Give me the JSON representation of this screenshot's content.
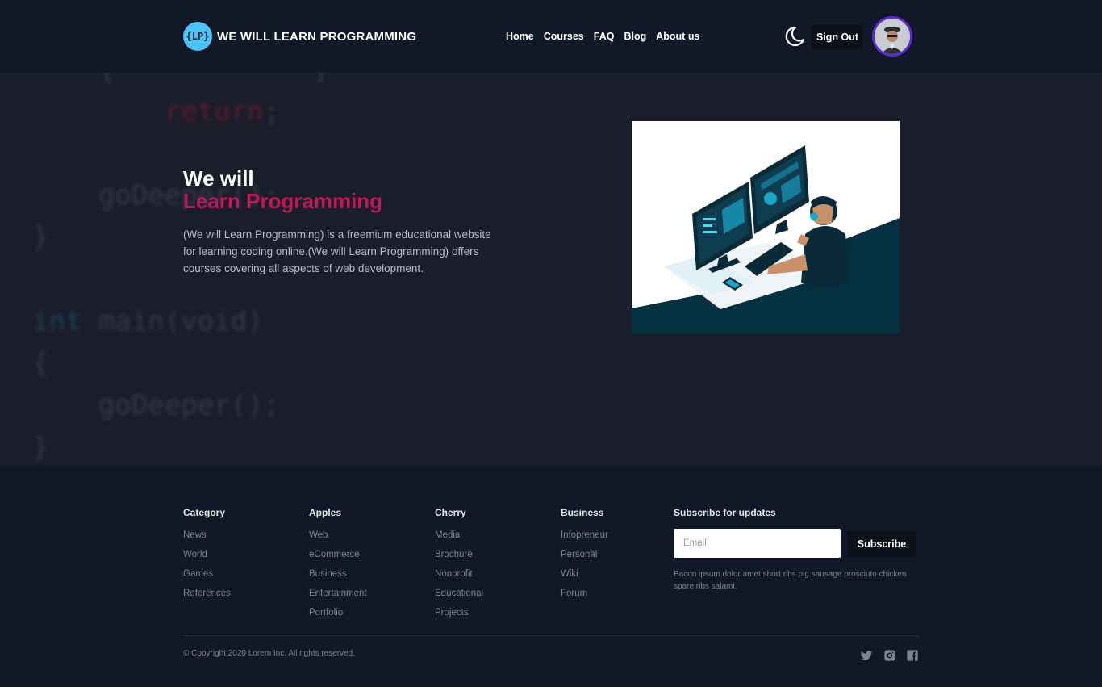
{
  "brand": {
    "logo_mark": "{LP}",
    "name": "WE WILL LEARN PROGRAMMING"
  },
  "nav": [
    "Home",
    "Courses",
    "FAQ",
    "Blog",
    "About us"
  ],
  "header": {
    "theme_icon": "moon-icon",
    "signout_label": "Sign Out",
    "avatar_icon": "user-avatar"
  },
  "hero": {
    "title_line1": "We will",
    "title_line2": "Learn Programming",
    "description": "(We will Learn Programming) is a freemium educational website for learning coding online.(We will Learn Programming) offers courses covering all aspects of web development."
  },
  "footer": {
    "columns": [
      {
        "title": "Category",
        "links": [
          "News",
          "World",
          "Games",
          "References"
        ]
      },
      {
        "title": "Apples",
        "links": [
          "Web",
          "eCommerce",
          "Business",
          "Entertainment",
          "Portfolio"
        ]
      },
      {
        "title": "Cherry",
        "links": [
          "Media",
          "Brochure",
          "Nonprofit",
          "Educational",
          "Projects"
        ]
      },
      {
        "title": "Business",
        "links": [
          "Infopreneur",
          "Personal",
          "Wiki",
          "Forum"
        ]
      }
    ],
    "subscribe": {
      "title": "Subscribe for updates",
      "placeholder": "Email",
      "button": "Subscribe",
      "note": "Bacon ipsum dolor amet short ribs pig sausage prosciuto chicken spare ribs salami."
    },
    "copyright": "© Copyright 2020 Lorem Inc. All rights reserved.",
    "social": [
      "twitter-icon",
      "instagram-icon",
      "facebook-icon"
    ]
  },
  "colors": {
    "accent": "#c2185b",
    "logo": "#4fc3f7",
    "avatar_ring": "#5b2bd1",
    "bg": "#1a1d2a",
    "header_bg": "#111827"
  }
}
